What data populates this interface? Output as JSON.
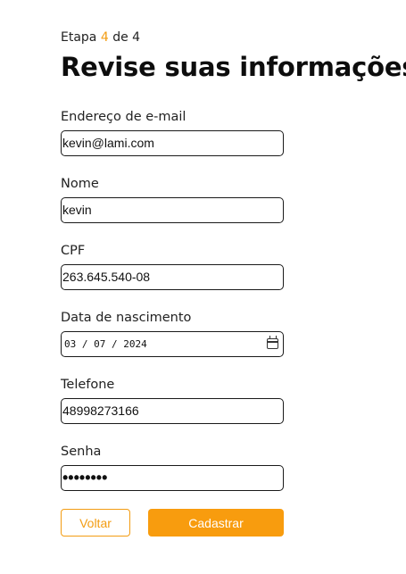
{
  "step": {
    "prefix": "Etapa",
    "current": "4",
    "separator": "de",
    "total": "4"
  },
  "title": "Revise suas informações",
  "fields": {
    "email": {
      "label": "Endereço de e-mail",
      "value": "kevin@lami.com"
    },
    "name": {
      "label": "Nome",
      "value": "kevin"
    },
    "cpf": {
      "label": "CPF",
      "value": "263.645.540-08"
    },
    "birthdate": {
      "label": "Data de nascimento",
      "value": "03 / 07 / 2024"
    },
    "phone": {
      "label": "Telefone",
      "value": "48998273166"
    },
    "password": {
      "label": "Senha",
      "value": "••••••••"
    }
  },
  "buttons": {
    "back": "Voltar",
    "submit": "Cadastrar"
  },
  "icons": {
    "calendar": "calendar-icon"
  },
  "colors": {
    "accent": "#f89c0e",
    "text": "#111111",
    "border": "#1a1a1a"
  }
}
